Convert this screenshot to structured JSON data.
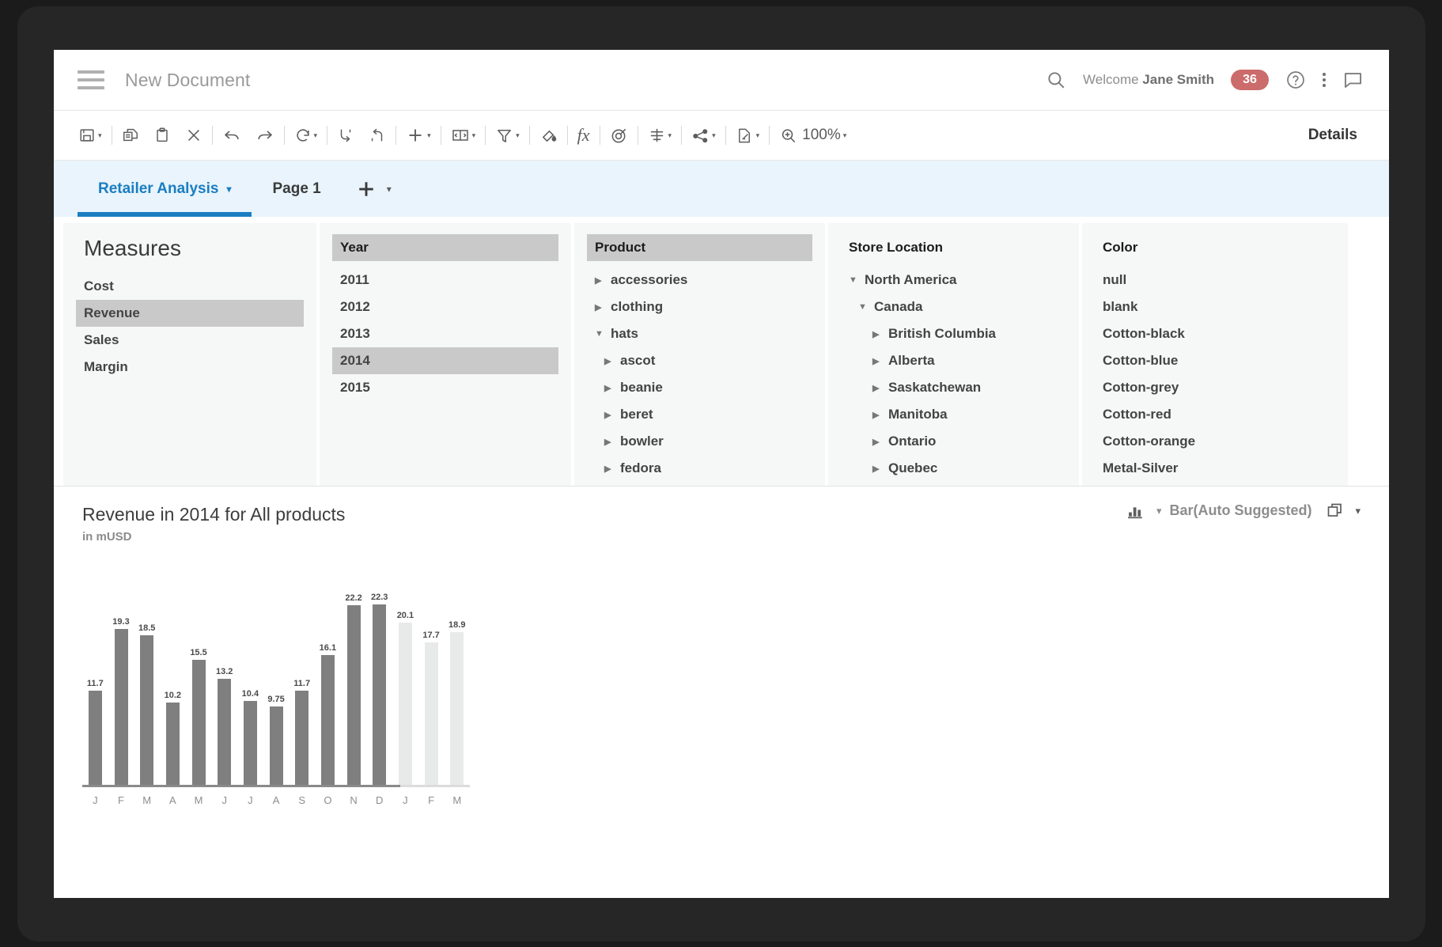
{
  "header": {
    "menu_icon": "hamburger-icon",
    "title": "New Document",
    "search_icon": "search-icon",
    "welcome_prefix": "Welcome ",
    "user_name": "Jane Smith",
    "notification_count": "36",
    "help_icon": "help-circle-icon",
    "more_icon": "kebab-menu-icon",
    "comment_icon": "comment-icon",
    "badge_color": "#cc6b6b"
  },
  "toolbar": {
    "buttons": [
      {
        "name": "save-button",
        "icon": "save-icon",
        "has_caret": true
      },
      {
        "name": "copy-button",
        "icon": "copy-icon",
        "has_caret": false
      },
      {
        "name": "paste-button",
        "icon": "paste-icon",
        "has_caret": false
      },
      {
        "name": "delete-button",
        "icon": "close-x-icon",
        "has_caret": false
      },
      {
        "name": "undo-button",
        "icon": "undo-arrow-icon",
        "has_caret": false
      },
      {
        "name": "redo-button",
        "icon": "redo-arrow-icon",
        "has_caret": false
      },
      {
        "name": "refresh-button",
        "icon": "refresh-icon",
        "has_caret": true
      },
      {
        "name": "drill-down-button",
        "icon": "drill-down-icon",
        "has_caret": false
      },
      {
        "name": "drill-up-button",
        "icon": "drill-up-icon",
        "has_caret": false
      },
      {
        "name": "insert-button",
        "icon": "plus-icon",
        "has_caret": true
      },
      {
        "name": "layout-button",
        "icon": "layout-icon",
        "has_caret": true
      },
      {
        "name": "filter-button",
        "icon": "funnel-icon",
        "has_caret": true
      },
      {
        "name": "highlight-button",
        "icon": "paint-bucket-icon",
        "has_caret": false
      },
      {
        "name": "formula-button",
        "icon": "fx-icon",
        "has_caret": false
      },
      {
        "name": "target-button",
        "icon": "target-icon",
        "has_caret": false
      },
      {
        "name": "sort-button",
        "icon": "sort-icon",
        "has_caret": true
      },
      {
        "name": "share-button",
        "icon": "share-node-icon",
        "has_caret": true
      },
      {
        "name": "export-button",
        "icon": "export-page-icon",
        "has_caret": true
      }
    ],
    "zoom_icon": "zoom-in-icon",
    "zoom_level": "100%",
    "details_label": "Details"
  },
  "tabbar": {
    "tabs": [
      {
        "label": "Retailer Analysis",
        "active": true,
        "has_caret": true
      },
      {
        "label": "Page 1",
        "active": false,
        "has_caret": false
      }
    ],
    "add_icon": "plus-icon",
    "add_caret": "▾"
  },
  "panels": [
    {
      "name": "measures",
      "header": "Measures",
      "header_style": "big",
      "items": [
        {
          "label": "Cost",
          "selected": false,
          "indent": 0,
          "marker": ""
        },
        {
          "label": "Revenue",
          "selected": true,
          "indent": 0,
          "marker": ""
        },
        {
          "label": "Sales",
          "selected": false,
          "indent": 0,
          "marker": ""
        },
        {
          "label": "Margin",
          "selected": false,
          "indent": 0,
          "marker": ""
        }
      ]
    },
    {
      "name": "year",
      "header": "Year",
      "header_style": "shaded",
      "items": [
        {
          "label": "2011",
          "selected": false,
          "indent": 0,
          "marker": ""
        },
        {
          "label": "2012",
          "selected": false,
          "indent": 0,
          "marker": ""
        },
        {
          "label": "2013",
          "selected": false,
          "indent": 0,
          "marker": ""
        },
        {
          "label": "2014",
          "selected": true,
          "indent": 0,
          "marker": ""
        },
        {
          "label": "2015",
          "selected": false,
          "indent": 0,
          "marker": ""
        }
      ]
    },
    {
      "name": "product",
      "header": "Product",
      "header_style": "shaded",
      "items": [
        {
          "label": "accessories",
          "selected": false,
          "indent": 0,
          "marker": "▶"
        },
        {
          "label": "clothing",
          "selected": false,
          "indent": 0,
          "marker": "▶"
        },
        {
          "label": "hats",
          "selected": false,
          "indent": 0,
          "marker": "▼"
        },
        {
          "label": "ascot",
          "selected": false,
          "indent": 1,
          "marker": "▶"
        },
        {
          "label": "beanie",
          "selected": false,
          "indent": 1,
          "marker": "▶"
        },
        {
          "label": "beret",
          "selected": false,
          "indent": 1,
          "marker": "▶"
        },
        {
          "label": "bowler",
          "selected": false,
          "indent": 1,
          "marker": "▶"
        },
        {
          "label": "fedora",
          "selected": false,
          "indent": 1,
          "marker": "▶"
        }
      ]
    },
    {
      "name": "store-location",
      "header": "Store Location",
      "header_style": "plain",
      "items": [
        {
          "label": "North America",
          "selected": false,
          "indent": 0,
          "marker": "▼"
        },
        {
          "label": "Canada",
          "selected": false,
          "indent": 1,
          "marker": "▼"
        },
        {
          "label": "British Columbia",
          "selected": false,
          "indent": 2,
          "marker": "▶"
        },
        {
          "label": "Alberta",
          "selected": false,
          "indent": 2,
          "marker": "▶"
        },
        {
          "label": "Saskatchewan",
          "selected": false,
          "indent": 2,
          "marker": "▶"
        },
        {
          "label": "Manitoba",
          "selected": false,
          "indent": 2,
          "marker": "▶"
        },
        {
          "label": "Ontario",
          "selected": false,
          "indent": 2,
          "marker": "▶"
        },
        {
          "label": "Quebec",
          "selected": false,
          "indent": 2,
          "marker": "▶"
        }
      ]
    },
    {
      "name": "color",
      "header": "Color",
      "header_style": "plain",
      "items": [
        {
          "label": "null",
          "selected": false,
          "indent": 0,
          "marker": ""
        },
        {
          "label": "blank",
          "selected": false,
          "indent": 0,
          "marker": ""
        },
        {
          "label": "Cotton-black",
          "selected": false,
          "indent": 0,
          "marker": ""
        },
        {
          "label": "Cotton-blue",
          "selected": false,
          "indent": 0,
          "marker": ""
        },
        {
          "label": "Cotton-grey",
          "selected": false,
          "indent": 0,
          "marker": ""
        },
        {
          "label": "Cotton-red",
          "selected": false,
          "indent": 0,
          "marker": ""
        },
        {
          "label": "Cotton-orange",
          "selected": false,
          "indent": 0,
          "marker": ""
        },
        {
          "label": "Metal-Silver",
          "selected": false,
          "indent": 0,
          "marker": ""
        }
      ]
    }
  ],
  "chart_panel": {
    "type_icon": "bar-chart-icon",
    "type_caret": "▾",
    "type_label": "Bar(Auto Suggested)",
    "duplicate_icon": "duplicate-icon",
    "duplicate_caret": "▾"
  },
  "chart_data": {
    "type": "bar",
    "title": "Revenue in 2014 for All products",
    "subtitle": "in mUSD",
    "xlabel": "",
    "ylabel": "",
    "ylim": [
      0,
      24
    ],
    "grid": false,
    "legend": "none",
    "bar_color": "#7f7f7f",
    "forecast_bar_color": "#e8eaea",
    "categories": [
      "J",
      "F",
      "M",
      "A",
      "M",
      "J",
      "J",
      "A",
      "S",
      "O",
      "N",
      "D",
      "J",
      "F",
      "M"
    ],
    "values": [
      11.7,
      19.3,
      18.5,
      10.2,
      15.5,
      13.2,
      10.4,
      9.75,
      11.7,
      16.1,
      22.2,
      22.3,
      20.1,
      17.7,
      18.9
    ],
    "labels": [
      "11.7",
      "19.3",
      "18.5",
      "10.2",
      "15.5",
      "13.2",
      "10.4",
      "9.75",
      "11.7",
      "16.1",
      "22.2",
      "22.3",
      "20.1",
      "17.7",
      "18.9"
    ],
    "forecast_flags": [
      false,
      false,
      false,
      false,
      false,
      false,
      false,
      false,
      false,
      false,
      false,
      false,
      true,
      true,
      true
    ]
  }
}
